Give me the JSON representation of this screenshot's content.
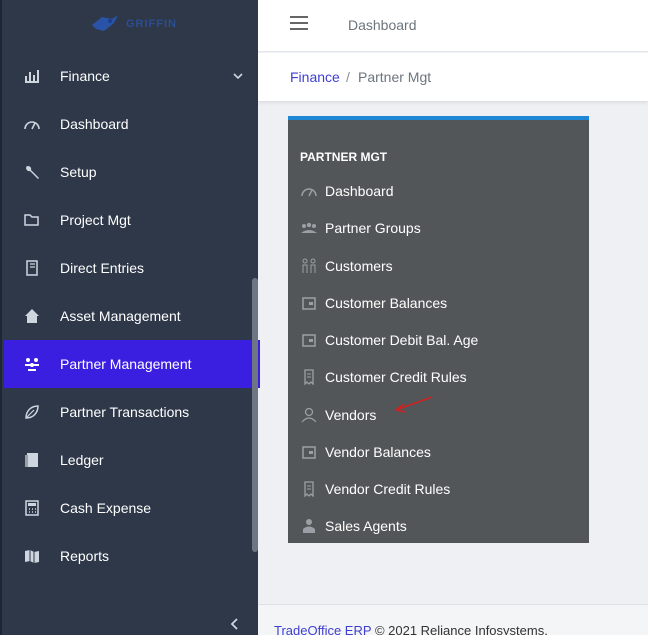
{
  "brand": {
    "logo_text": "GRIFFIN",
    "accent": "#3a1fe0"
  },
  "topbar": {
    "title": "Dashboard"
  },
  "breadcrumb": {
    "parent": "Finance",
    "separator": "/",
    "current": "Partner Mgt"
  },
  "sidebar": {
    "items": [
      {
        "label": "Finance",
        "icon": "finance-icon",
        "expandable": true
      },
      {
        "label": "Dashboard",
        "icon": "dashboard-icon"
      },
      {
        "label": "Setup",
        "icon": "wrench-icon"
      },
      {
        "label": "Project Mgt",
        "icon": "folder-icon"
      },
      {
        "label": "Direct Entries",
        "icon": "book-icon"
      },
      {
        "label": "Asset Management",
        "icon": "house-icon"
      },
      {
        "label": "Partner Management",
        "icon": "group-icon",
        "active": true
      },
      {
        "label": "Partner Transactions",
        "icon": "leaf-icon"
      },
      {
        "label": "Ledger",
        "icon": "ledger-icon"
      },
      {
        "label": "Cash Expense",
        "icon": "calculator-icon"
      },
      {
        "label": "Reports",
        "icon": "map-icon"
      }
    ]
  },
  "panel": {
    "title": "PARTNER MGT",
    "items": [
      {
        "label": "Dashboard",
        "icon": "dashboard-icon"
      },
      {
        "label": "Partner Groups",
        "icon": "group-icon"
      },
      {
        "label": "Customers",
        "icon": "people-icon"
      },
      {
        "label": "Customer Balances",
        "icon": "wallet-icon"
      },
      {
        "label": "Customer Debit Bal. Age",
        "icon": "wallet-icon"
      },
      {
        "label": "Customer Credit Rules",
        "icon": "receipt-icon"
      },
      {
        "label": "Vendors",
        "icon": "user-icon"
      },
      {
        "label": "Vendor Balances",
        "icon": "wallet-icon"
      },
      {
        "label": "Vendor Credit Rules",
        "icon": "receipt-icon"
      },
      {
        "label": "Sales Agents",
        "icon": "agent-icon"
      }
    ]
  },
  "footer": {
    "product": "TradeOffice ERP",
    "copyright": "© 2021 Reliance Infosystems."
  }
}
